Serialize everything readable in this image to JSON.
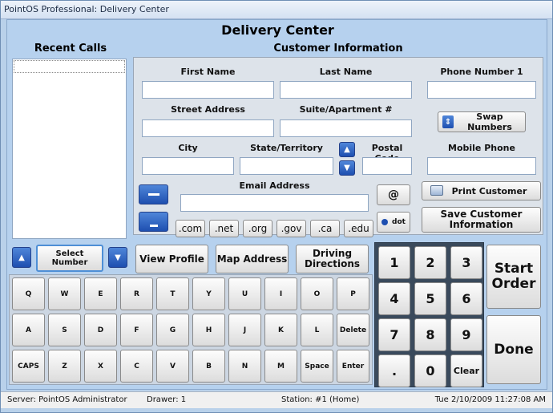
{
  "window": {
    "title": "PointOS Professional: Delivery Center"
  },
  "header": {
    "title": "Delivery Center",
    "recent_calls": "Recent Calls",
    "customer_info": "Customer Information"
  },
  "fields": {
    "first_name": "First Name",
    "last_name": "Last Name",
    "phone1": "Phone Number 1",
    "street": "Street Address",
    "suite": "Suite/Apartment #",
    "city": "City",
    "state": "State/Territory",
    "postal": "Postal Code",
    "mobile": "Mobile Phone",
    "email": "Email Address"
  },
  "buttons": {
    "swap": "Swap Numbers",
    "at": "@",
    "dot": "dot",
    "print": "Print Customer",
    "save": "Save Customer Information",
    "select_number": "Select Number",
    "view_profile": "View Profile",
    "map_address": "Map Address",
    "driving": "Driving Directions",
    "start_order": "Start Order",
    "done": "Done"
  },
  "domains": [
    ".com",
    ".net",
    ".org",
    ".gov",
    ".ca",
    ".edu"
  ],
  "keyboard": [
    [
      "Q",
      "W",
      "E",
      "R",
      "T",
      "Y",
      "U",
      "I",
      "O",
      "P"
    ],
    [
      "A",
      "S",
      "D",
      "F",
      "G",
      "H",
      "J",
      "K",
      "L",
      "Delete"
    ],
    [
      "CAPS",
      "Z",
      "X",
      "C",
      "V",
      "B",
      "N",
      "M",
      "Space",
      "Enter"
    ]
  ],
  "numpad": [
    [
      "1",
      "2",
      "3"
    ],
    [
      "4",
      "5",
      "6"
    ],
    [
      "7",
      "8",
      "9"
    ],
    [
      ".",
      "0",
      "Clear"
    ]
  ],
  "status": {
    "server": "Server: PointOS Administrator",
    "drawer": "Drawer: 1",
    "station": "Station: #1 (Home)",
    "datetime": "Tue 2/10/2009 11:27:08 AM"
  },
  "colors": {
    "accent_blue": "#1e4fb0",
    "panel_bg": "#b6d1ee"
  }
}
